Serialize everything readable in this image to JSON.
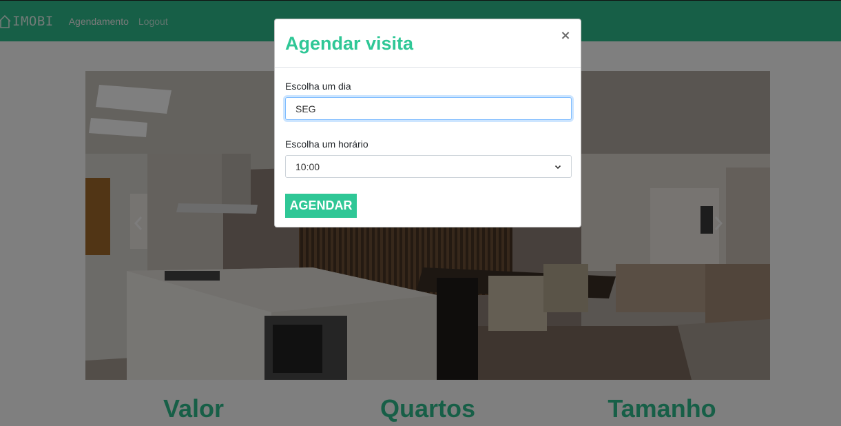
{
  "navbar": {
    "brand": "IMOBI",
    "brand_icon": "house-outline-icon",
    "links": [
      {
        "label": "Agendamento"
      },
      {
        "label": "Logout"
      }
    ],
    "color": "#2fbf8e"
  },
  "hero": {
    "image": "apartment-kitchen-and-living-room-photo",
    "prev_icon": "chevron-left-icon",
    "next_icon": "chevron-right-icon"
  },
  "stats": {
    "items": [
      {
        "title": "Valor"
      },
      {
        "title": "Quartos"
      },
      {
        "title": "Tamanho"
      }
    ]
  },
  "modal": {
    "title": "Agendar visita",
    "close_label": "×",
    "day": {
      "label": "Escolha um dia",
      "value": "SEG"
    },
    "time": {
      "label": "Escolha um horário",
      "selected": "10:00"
    },
    "submit_label": "AGENDAR",
    "accent_color": "#2fc796"
  }
}
